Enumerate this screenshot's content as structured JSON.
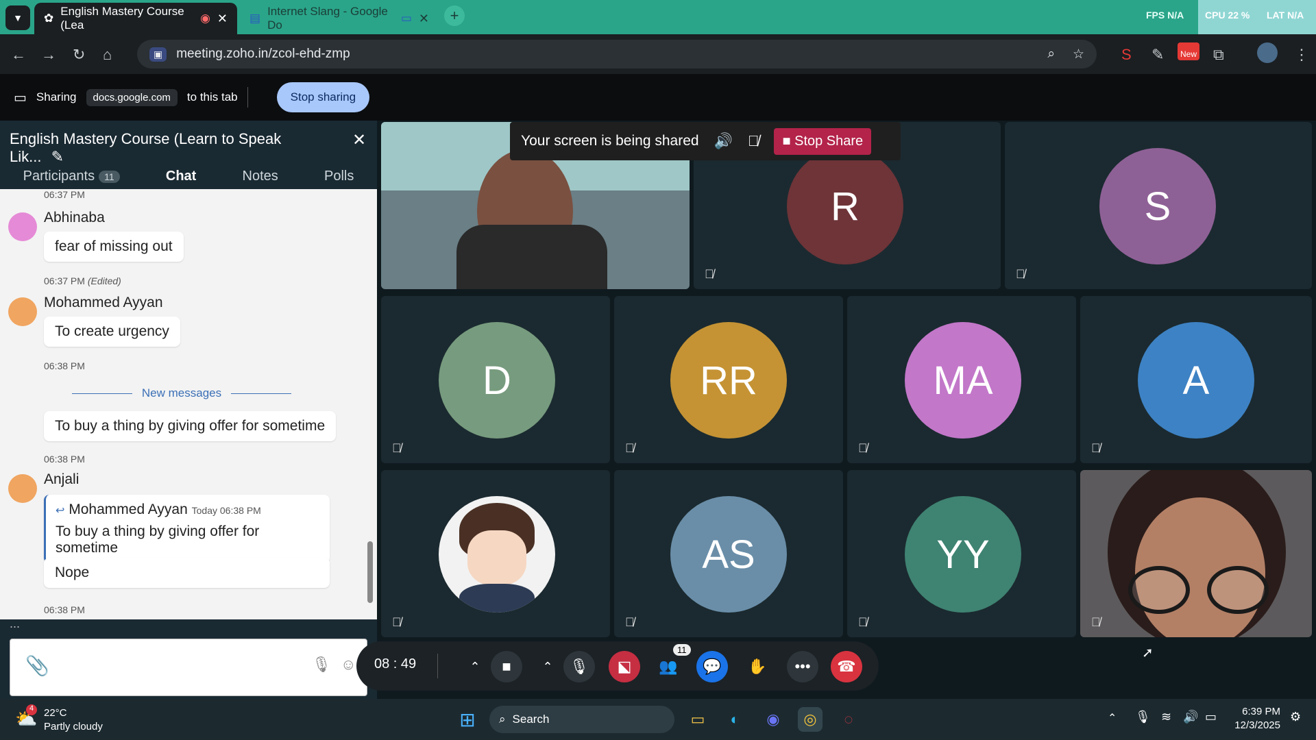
{
  "browser": {
    "tabs": [
      {
        "title": "English Mastery Course (Lea",
        "active": true
      },
      {
        "title": "Internet Slang - Google Do",
        "active": false
      }
    ],
    "new_tab": "+",
    "stats": {
      "fps_label": "FPS",
      "fps_value": "N/A",
      "cpu_label": "CPU",
      "cpu_value": "22 %",
      "lat_label": "LAT",
      "lat_value": "N/A"
    },
    "url": "meeting.zoho.in/zcol-ehd-zmp",
    "ext_new_badge": "New"
  },
  "sharing_bar": {
    "label": "Sharing",
    "domain": "docs.google.com",
    "suffix": "to this tab",
    "stop_button": "Stop sharing"
  },
  "panel": {
    "title": "English Mastery Course (Learn to Speak Lik...",
    "tabs": [
      {
        "label": "Participants",
        "badge": "11"
      },
      {
        "label": "Chat"
      },
      {
        "label": "Notes"
      },
      {
        "label": "Polls"
      }
    ],
    "chat": {
      "top_time": "06:37 PM",
      "messages": [
        {
          "name": "Abhinaba",
          "text": "fear of missing out",
          "time": "06:37 PM",
          "edited": "(Edited)",
          "avatar_color": "#e58ad6"
        },
        {
          "name": "Mohammed Ayyan",
          "text": "To create urgency",
          "time": "06:38 PM",
          "avatar_color": "#f0a560"
        },
        {
          "text": "To buy a thing by giving offer for sometime",
          "time": "06:38 PM"
        },
        {
          "name": "Anjali",
          "reply_to": "Mohammed Ayyan",
          "reply_time": "Today 06:38 PM",
          "reply_text": "To buy a thing by giving offer for sometime",
          "text": "Nope",
          "time": "06:38 PM",
          "avatar_color": "#f0a560"
        }
      ],
      "new_messages_label": "New messages",
      "typing": "..."
    }
  },
  "share_notice": {
    "text": "Your screen is being shared",
    "stop": "Stop Share"
  },
  "participants": [
    {
      "initials": "R",
      "color": "#6e3438"
    },
    {
      "initials": "S",
      "color": "#8e6196"
    },
    {
      "initials": "D",
      "color": "#779b7e"
    },
    {
      "initials": "RR",
      "color": "#c59334"
    },
    {
      "initials": "MA",
      "color": "#c277c9"
    },
    {
      "initials": "A",
      "color": "#3d82c4"
    },
    {
      "initials": "AS",
      "color": "#6a8ea8"
    },
    {
      "initials": "YY",
      "color": "#3f8372"
    }
  ],
  "toolbar": {
    "timer": "08 : 49",
    "participants_count": "11"
  },
  "taskbar": {
    "weather_badge": "4",
    "temp": "22°C",
    "condition": "Partly cloudy",
    "search": "Search",
    "time": "6:39 PM",
    "date": "12/3/2025"
  }
}
